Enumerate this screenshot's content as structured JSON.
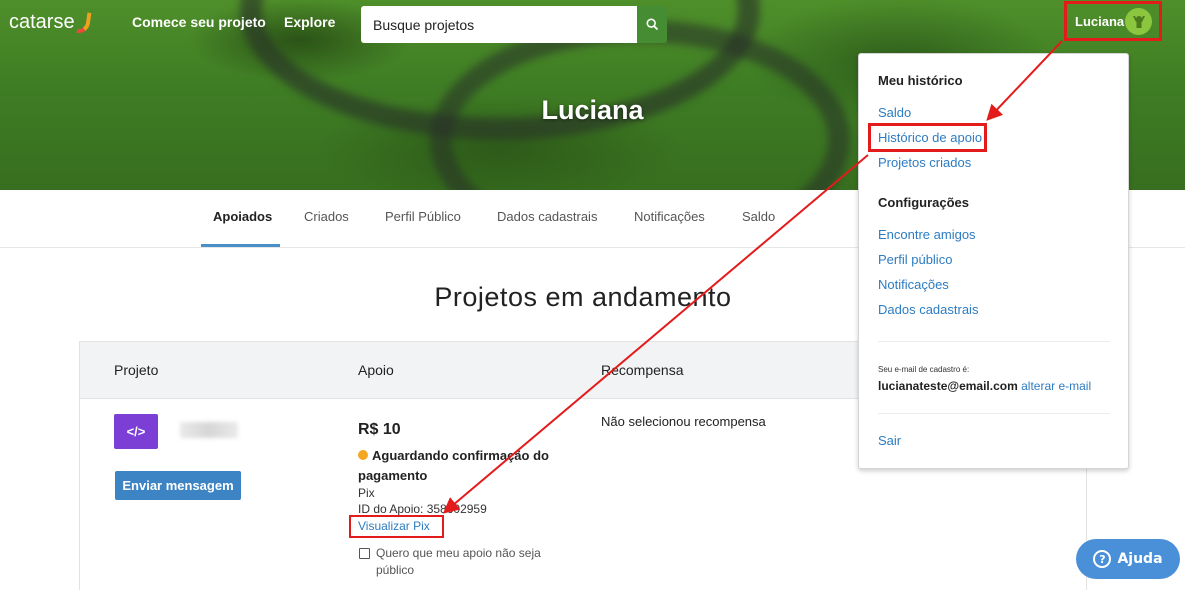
{
  "header": {
    "logo_text": "catarse",
    "nav": [
      "Comece seu projeto",
      "Explore"
    ],
    "search_placeholder": "Busque projetos",
    "user_name": "Luciana"
  },
  "hero": {
    "title": "Luciana"
  },
  "tabs": [
    "Apoiados",
    "Criados",
    "Perfil Público",
    "Dados cadastrais",
    "Notificações",
    "Saldo"
  ],
  "active_tab": "Apoiados",
  "main": {
    "section_title": "Projetos em andamento",
    "columns": [
      "Projeto",
      "Apoio",
      "Recompensa"
    ],
    "row": {
      "icon_text": "</>",
      "message_button": "Enviar mensagem",
      "amount": "R$ 10",
      "status": "Aguardando confirmação do pagamento",
      "payment_method": "Pix",
      "support_id": "ID do Apoio: 358602959",
      "view_pix": "Visualizar Pix",
      "private_checkbox": "Quero que meu apoio não seja público",
      "reward": "Não selecionou recompensa"
    }
  },
  "dropdown": {
    "history_heading": "Meu histórico",
    "history_items": [
      "Saldo",
      "Histórico de apoio",
      "Projetos criados"
    ],
    "settings_heading": "Configurações",
    "settings_items": [
      "Encontre amigos",
      "Perfil público",
      "Notificações",
      "Dados cadastrais"
    ],
    "email_label": "Seu e-mail de cadastro é:",
    "email": "lucianateste@email.com",
    "change_email": "alterar e-mail",
    "logout": "Sair"
  },
  "help_button": "Ajuda",
  "colors": {
    "brand_green": "#4f8f2a",
    "link_blue": "#2d7cc1",
    "annotation_red": "#e31b1b",
    "pending_orange": "#f5a623"
  }
}
